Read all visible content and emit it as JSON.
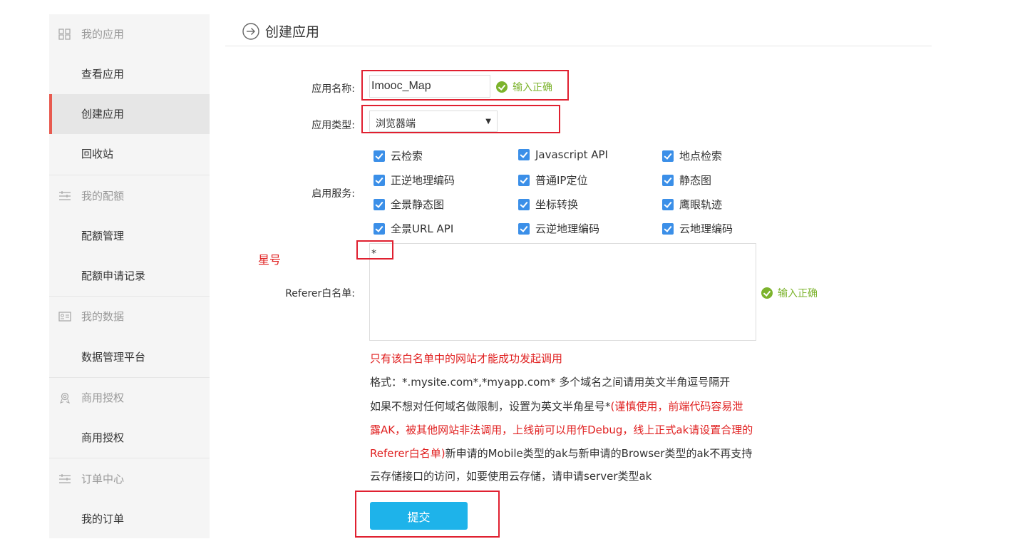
{
  "sidebar": {
    "groups": [
      {
        "label": "我的应用",
        "icon": "grid-icon",
        "items": [
          "查看应用",
          "创建应用",
          "回收站"
        ]
      },
      {
        "label": "我的配额",
        "icon": "list-icon",
        "items": [
          "配额管理",
          "配额申请记录"
        ]
      },
      {
        "label": "我的数据",
        "icon": "id-card-icon",
        "items": [
          "数据管理平台"
        ]
      },
      {
        "label": "商用授权",
        "icon": "award-icon",
        "items": [
          "商用授权"
        ]
      },
      {
        "label": "订单中心",
        "icon": "list-icon",
        "items": [
          "我的订单"
        ]
      }
    ],
    "active_item": "创建应用"
  },
  "page": {
    "title": "创建应用"
  },
  "form": {
    "name_label": "应用名称:",
    "name_value": "Imooc_Map",
    "name_status": "输入正确",
    "type_label": "应用类型:",
    "type_value": "浏览器端",
    "services_label": "启用服务:",
    "services": [
      [
        "云检索",
        "Javascript API",
        "地点检索"
      ],
      [
        "正逆地理编码",
        "普通IP定位",
        "静态图"
      ],
      [
        "全景静态图",
        "坐标转换",
        "鹰眼轨迹"
      ],
      [
        "全景URL API",
        "云逆地理编码",
        "云地理编码"
      ]
    ],
    "referer_label": "Referer白名单:",
    "referer_value": "*",
    "referer_status": "输入正确",
    "notes": {
      "line1": "只有该白名单中的网站才能成功发起调用",
      "line2": "格式：*.mysite.com*,*myapp.com* 多个域名之间请用英文半角逗号隔开",
      "line3_black": "如果不想对任何域名做限制，设置为英文半角星号*",
      "line3_red": "(谨慎使用，前端代码容易泄",
      "line4_red": "露AK，被其他网站非法调用，上线前可以用作Debug，线上正式ak请设置合理的",
      "line5_red": "Referer白名单)",
      "line5_black": "新申请的Mobile类型的ak与新申请的Browser类型的ak不再支持",
      "line6": "云存储接口的访问，如要使用云存储，请申请server类型ak"
    },
    "submit_label": "提交"
  },
  "annotations": {
    "asterisk_label": "星号"
  },
  "colors": {
    "accent": "#1eb3ea",
    "ok": "#7cb32c",
    "checkbox": "#3b8fe8",
    "annotation": "#e02030",
    "sidebar_active": "#e85a4f"
  }
}
